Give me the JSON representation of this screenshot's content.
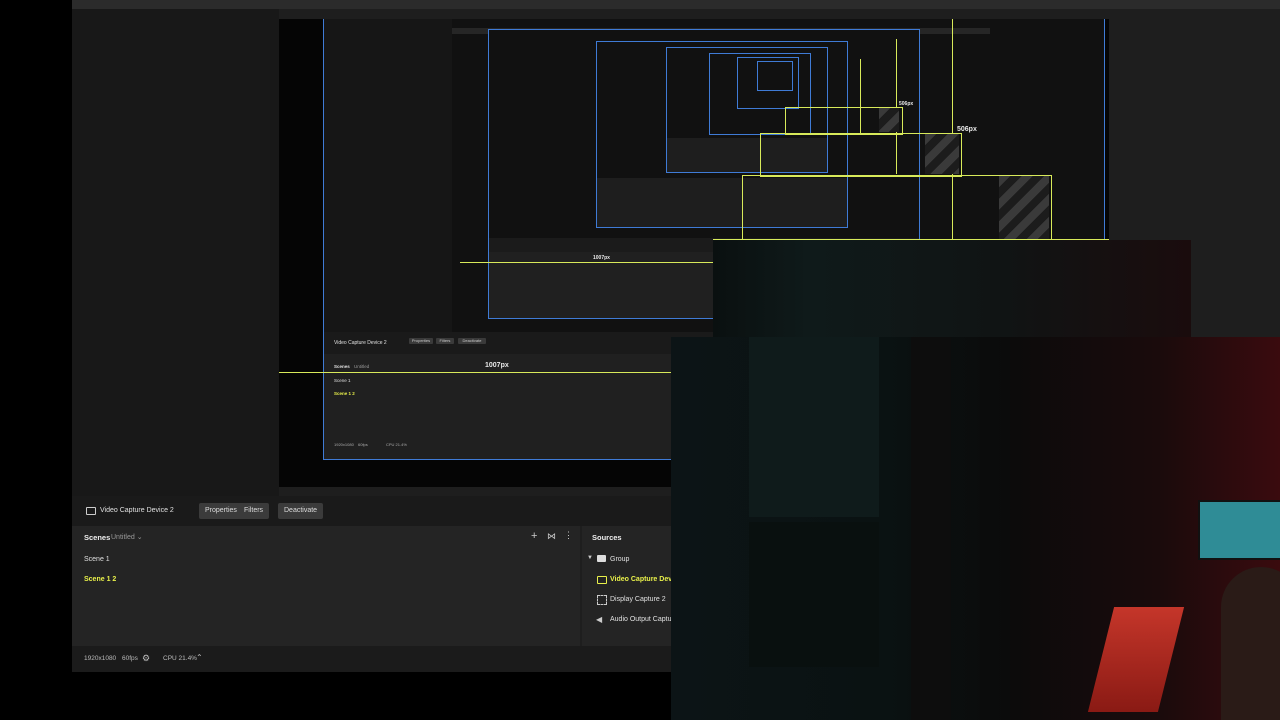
{
  "window": {
    "title": ""
  },
  "source_toolbar": {
    "source_name": "Video Capture Device 2",
    "properties_label": "Properties",
    "filters_label": "Filters",
    "deactivate_label": "Deactivate"
  },
  "scenes": {
    "header": "Scenes",
    "collection": "Untitled",
    "items": [
      {
        "label": "Scene 1",
        "active": false
      },
      {
        "label": "Scene 1 2",
        "active": true
      }
    ]
  },
  "sources": {
    "header": "Sources",
    "items": [
      {
        "label": "Group",
        "icon": "folder-icon",
        "active": false
      },
      {
        "label": "Video Capture Dev",
        "icon": "camera-icon",
        "active": true
      },
      {
        "label": "Display Capture 2",
        "icon": "display-capture-icon",
        "active": false
      },
      {
        "label": "Audio Output Captu",
        "icon": "speaker-icon",
        "active": false
      }
    ]
  },
  "status": {
    "resolution": "1920x1080",
    "fps": "60fps",
    "cpu": "CPU 21.4%"
  },
  "measurements": {
    "width_1": "1007px",
    "width_2": "1007px",
    "width_3": "506px",
    "width_4": "506px"
  },
  "nested_preview": {
    "source_name": "Video Capture Device 2",
    "properties_label": "Properties",
    "filters_label": "Filters",
    "deactivate_label": "Deactivate",
    "scenes_header": "Scenes",
    "collection": "Untitled",
    "scene_1": "Scene 1",
    "scene_2": "Scene 1 2",
    "resolution": "1920x1080",
    "fps": "60fps",
    "cpu": "CPU 21.4%"
  },
  "colors": {
    "accent_yellow": "#e8f04a",
    "selection_blue": "#3f7bd6",
    "guide_yellow": "#d8ea5a"
  }
}
